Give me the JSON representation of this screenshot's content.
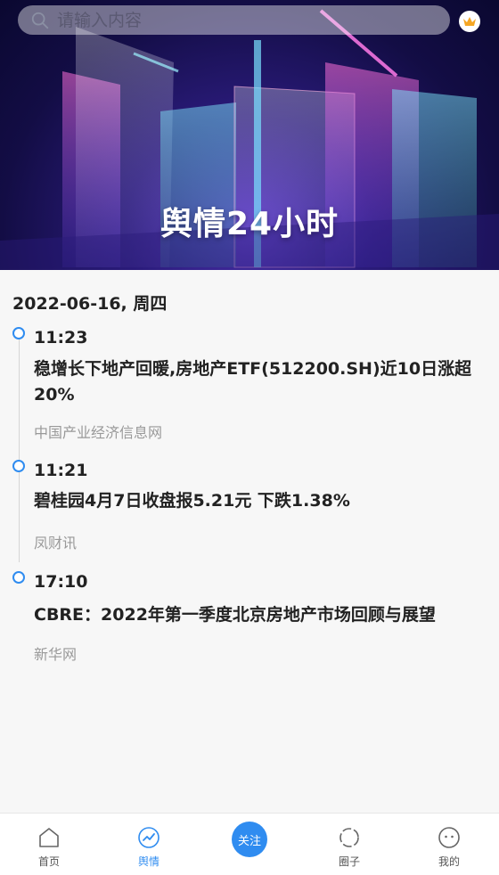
{
  "search": {
    "placeholder": "请输入内容"
  },
  "hero": {
    "title": "舆情24小时"
  },
  "date_header": "2022-06-16, 周四",
  "entries": [
    {
      "time": "11:23",
      "title": "稳增长下地产回暖,房地产ETF(512200.SH)近10日涨超20%",
      "source": "中国产业经济信息网"
    },
    {
      "time": "11:21",
      "title": "碧桂园4月7日收盘报5.21元 下跌1.38%",
      "source": "凤财讯"
    },
    {
      "time": "17:10",
      "title": "CBRE：2022年第一季度北京房地产市场回顾与展望",
      "source": "新华网"
    }
  ],
  "nav": {
    "home": "首页",
    "yuqing": "舆情",
    "follow": "关注",
    "circle": "圈子",
    "mine": "我的"
  },
  "colors": {
    "accent": "#2f8cf0",
    "hero_bg": "#1a1260"
  }
}
